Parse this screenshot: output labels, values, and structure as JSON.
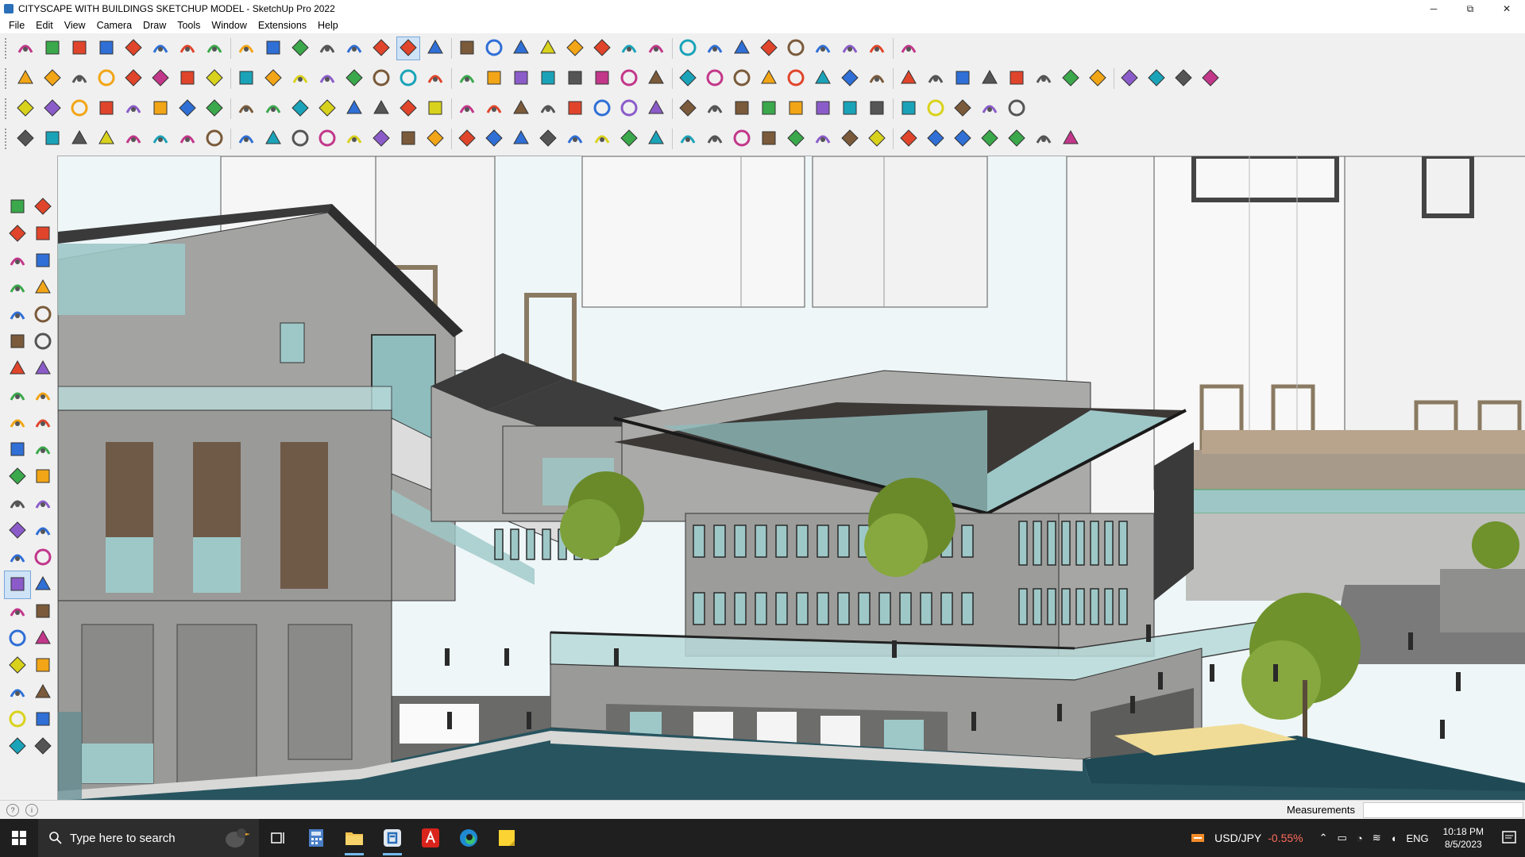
{
  "window": {
    "title": "CITYSCAPE WITH BUILDINGS SKETCHUP MODEL - SketchUp Pro 2022",
    "minimize_glyph": "─",
    "maximize_glyph": "⧉",
    "close_glyph": "✕"
  },
  "menu": [
    "File",
    "Edit",
    "View",
    "Camera",
    "Draw",
    "Tools",
    "Window",
    "Extensions",
    "Help"
  ],
  "status": {
    "measurements_label": "Measurements",
    "measurements_value": "",
    "icon1": "?",
    "icon2": "i"
  },
  "taskbar": {
    "search_placeholder": "Type here to search",
    "ticker_symbol": "USD/JPY",
    "ticker_change": "-0.55%",
    "language": "ENG",
    "time": "10:18 PM",
    "date": "8/5/2023",
    "apps": [
      "task-view",
      "calculator",
      "file-explorer",
      "sketchup",
      "acrobat",
      "edge",
      "sticky-notes"
    ]
  },
  "colors": {
    "accent": "#2a6fb8",
    "taskbar": "#1f1f1f",
    "water": "#27545f",
    "sky": "#eef6f8",
    "roof": "#3a3a3a",
    "stone": "#9a9a98",
    "glass": "#9ec8c8",
    "ticker_down": "#ff6b5b"
  },
  "icons": {
    "row1": [
      "zoom-icon",
      "select-icon",
      "eraser-icon",
      "pencil-icon",
      "lasso-icon",
      "rectangle-icon",
      "push-pull-icon",
      "follow-me-icon",
      "move-icon",
      "rotate-icon",
      "scale-icon",
      "tape-icon",
      "text-icon",
      "paint-icon",
      "orbit-icon",
      "pan-icon",
      "zoom-window-icon",
      "zoom-extents-icon",
      "view-iso-icon",
      "view-top-icon",
      "view-front-icon",
      "view-right-icon",
      "user-icon",
      "component-icon",
      "section-icon",
      "axes-icon",
      "arrow-up-icon",
      "arrow-down-icon",
      "measure-icon",
      "warehouse-icon",
      "undo-icon",
      "redo-icon",
      "extension-icon"
    ],
    "row2": [
      "box-icon",
      "shade-icon",
      "wireframe-icon",
      "explode-icon",
      "down-arrow-icon",
      "back-arrow-icon",
      "right-arrow-icon",
      "left-arrow-icon",
      "north-arrow-icon",
      "east-arrow-icon",
      "fwd-arrow-icon",
      "leaf-icon",
      "solid-blue-icon",
      "solid-purple-icon",
      "solid-violet-icon",
      "tile-icon",
      "star-icon",
      "house1-icon",
      "house2-icon",
      "house3-icon",
      "house4-icon",
      "house5-icon",
      "fe-icon",
      "tag-icon",
      "knife-icon",
      "circle1-icon",
      "circle2-icon",
      "hex-icon",
      "ellipse-icon",
      "parallel-icon",
      "curve-icon",
      "ring-icon",
      "arc-icon",
      "loop-icon",
      "spiral-icon",
      "measure2-icon",
      "magnet-icon",
      "grid-icon",
      "cube1-icon",
      "cube2-icon",
      "cube3-icon",
      "cube4-icon",
      "cube5-icon",
      "cube6-icon"
    ],
    "row3": [
      "blue-plane-icon",
      "cyan-plane-icon",
      "yellow-plane-icon",
      "green-plane-icon",
      "red-plane-icon",
      "loop-orange-icon",
      "square-red-icon",
      "stack-icon",
      "flag-icon",
      "box-brown-icon",
      "chain-icon",
      "curve-gray-icon",
      "path-red-icon",
      "plus-red-icon",
      "plus-green-icon",
      "x-blue-icon",
      "cone-cyan-icon",
      "lamp-icon",
      "triangle-icon",
      "spin-icon",
      "gear-orange-icon",
      "refresh-icon",
      "sparkle-icon",
      "cup-icon",
      "magnet-red-icon",
      "tree-icon",
      "arrows-icon",
      "shape1-icon",
      "shape2-icon",
      "shape3-icon",
      "shape4-icon",
      "window-icon",
      "grid-orange-icon",
      "grid-orange2-icon",
      "x-red-icon",
      "dots-icon",
      "squares-icon"
    ],
    "row4": [
      "curve-line-icon",
      "bezier-icon",
      "car-icon",
      "scissors-icon",
      "gear-gray-icon",
      "shoe-icon",
      "hook-icon",
      "cube-outline-icon",
      "ball-icon",
      "hat-icon",
      "corner1-icon",
      "corner2-icon",
      "arrow-red-icon",
      "shell-icon",
      "castle-icon",
      "prism-icon",
      "cols1-icon",
      "cols2-icon",
      "net-icon",
      "leaf2-icon",
      "wing-icon",
      "page-icon",
      "blade-icon",
      "fan-icon",
      "fan2-icon",
      "fan3-icon",
      "machine-icon",
      "stack2-icon",
      "bench-icon",
      "door-icon",
      "grid2-icon",
      "grid3-icon",
      "grid4-icon",
      "grid5-icon",
      "ball2-icon",
      "ball3-icon",
      "wedge-icon",
      "ribs-icon",
      "gem-icon"
    ],
    "left": [
      "select-icon",
      "orbit-icon",
      "paint-icon",
      "eraser-icon",
      "component-icon",
      "pencil-icon",
      "line-icon",
      "freehand-icon",
      "rectangle-icon",
      "rotated-rect-icon",
      "circle-icon",
      "polygon-icon",
      "arc-icon",
      "pie-icon",
      "arc2-icon",
      "arc3-icon",
      "move-icon",
      "push-pull-icon",
      "rotate-icon",
      "follow-me-icon",
      "scale-icon",
      "offset-icon",
      "tape-icon",
      "dimension-icon",
      "protractor-icon",
      "text-icon",
      "axes-icon",
      "3d-text-icon",
      "orbit2-icon",
      "pan-icon",
      "zoom-icon",
      "zoom-window-icon",
      "zoom-extents-icon",
      "previous-icon",
      "position-camera-icon",
      "look-around-icon",
      "walk-icon",
      "section-plane-icon",
      "sandbox-icon",
      "smoove-icon",
      "stamp-icon",
      "drape-icon"
    ]
  }
}
